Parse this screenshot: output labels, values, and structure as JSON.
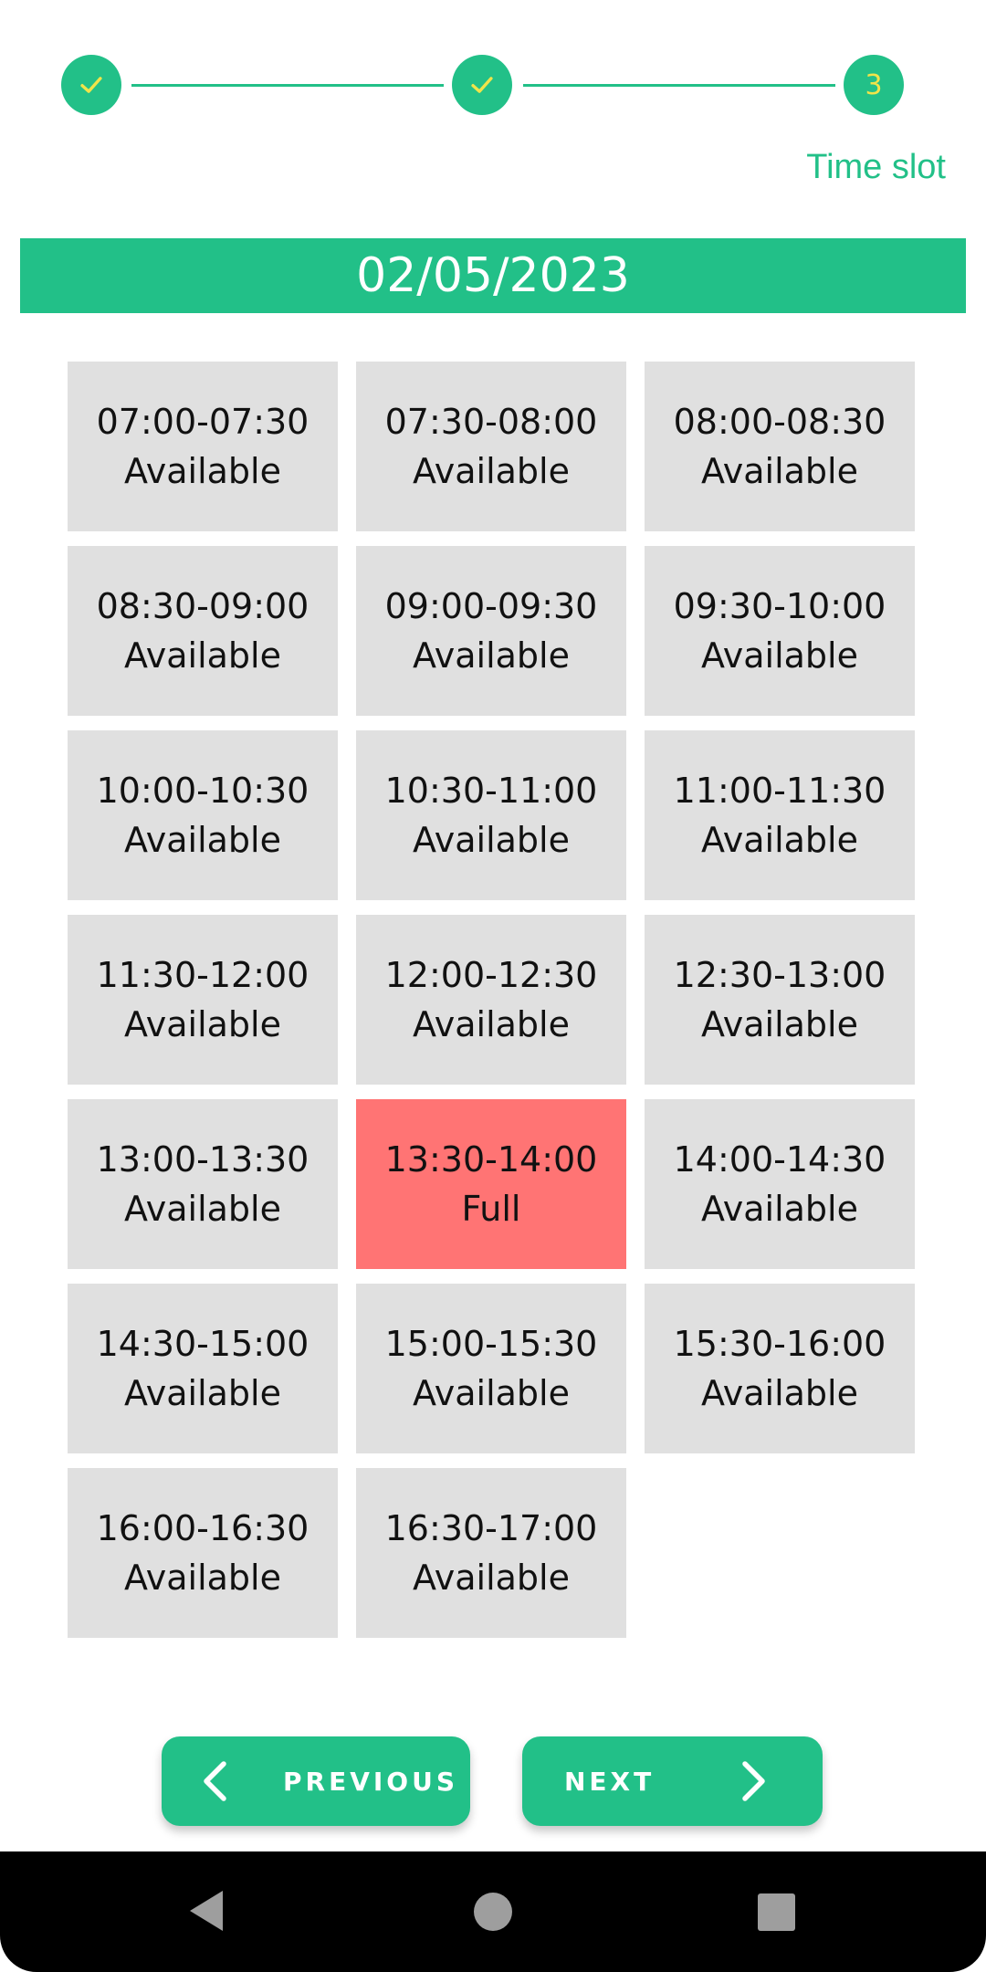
{
  "stepper": {
    "steps": [
      {
        "state": "done",
        "icon": "check-icon"
      },
      {
        "state": "done",
        "icon": "check-icon"
      },
      {
        "state": "current",
        "number": "3"
      }
    ],
    "current_label": "Time slot"
  },
  "date": "02/05/2023",
  "slots": [
    {
      "time": "07:00-07:30",
      "status": "Available"
    },
    {
      "time": "07:30-08:00",
      "status": "Available"
    },
    {
      "time": "08:00-08:30",
      "status": "Available"
    },
    {
      "time": "08:30-09:00",
      "status": "Available"
    },
    {
      "time": "09:00-09:30",
      "status": "Available"
    },
    {
      "time": "09:30-10:00",
      "status": "Available"
    },
    {
      "time": "10:00-10:30",
      "status": "Available"
    },
    {
      "time": "10:30-11:00",
      "status": "Available"
    },
    {
      "time": "11:00-11:30",
      "status": "Available"
    },
    {
      "time": "11:30-12:00",
      "status": "Available"
    },
    {
      "time": "12:00-12:30",
      "status": "Available"
    },
    {
      "time": "12:30-13:00",
      "status": "Available"
    },
    {
      "time": "13:00-13:30",
      "status": "Available"
    },
    {
      "time": "13:30-14:00",
      "status": "Full"
    },
    {
      "time": "14:00-14:30",
      "status": "Available"
    },
    {
      "time": "14:30-15:00",
      "status": "Available"
    },
    {
      "time": "15:00-15:30",
      "status": "Available"
    },
    {
      "time": "15:30-16:00",
      "status": "Available"
    },
    {
      "time": "16:00-16:30",
      "status": "Available"
    },
    {
      "time": "16:30-17:00",
      "status": "Available"
    }
  ],
  "buttons": {
    "previous_label": "PREVIOUS",
    "next_label": "NEXT"
  },
  "nav": {
    "back_icon": "back-triangle-icon",
    "home_icon": "home-circle-icon",
    "recents_icon": "recents-square-icon"
  },
  "colors": {
    "accent": "#22c088",
    "slot_available": "#e0e0e0",
    "slot_full": "#ff7474",
    "step_number": "#f0e44a"
  }
}
